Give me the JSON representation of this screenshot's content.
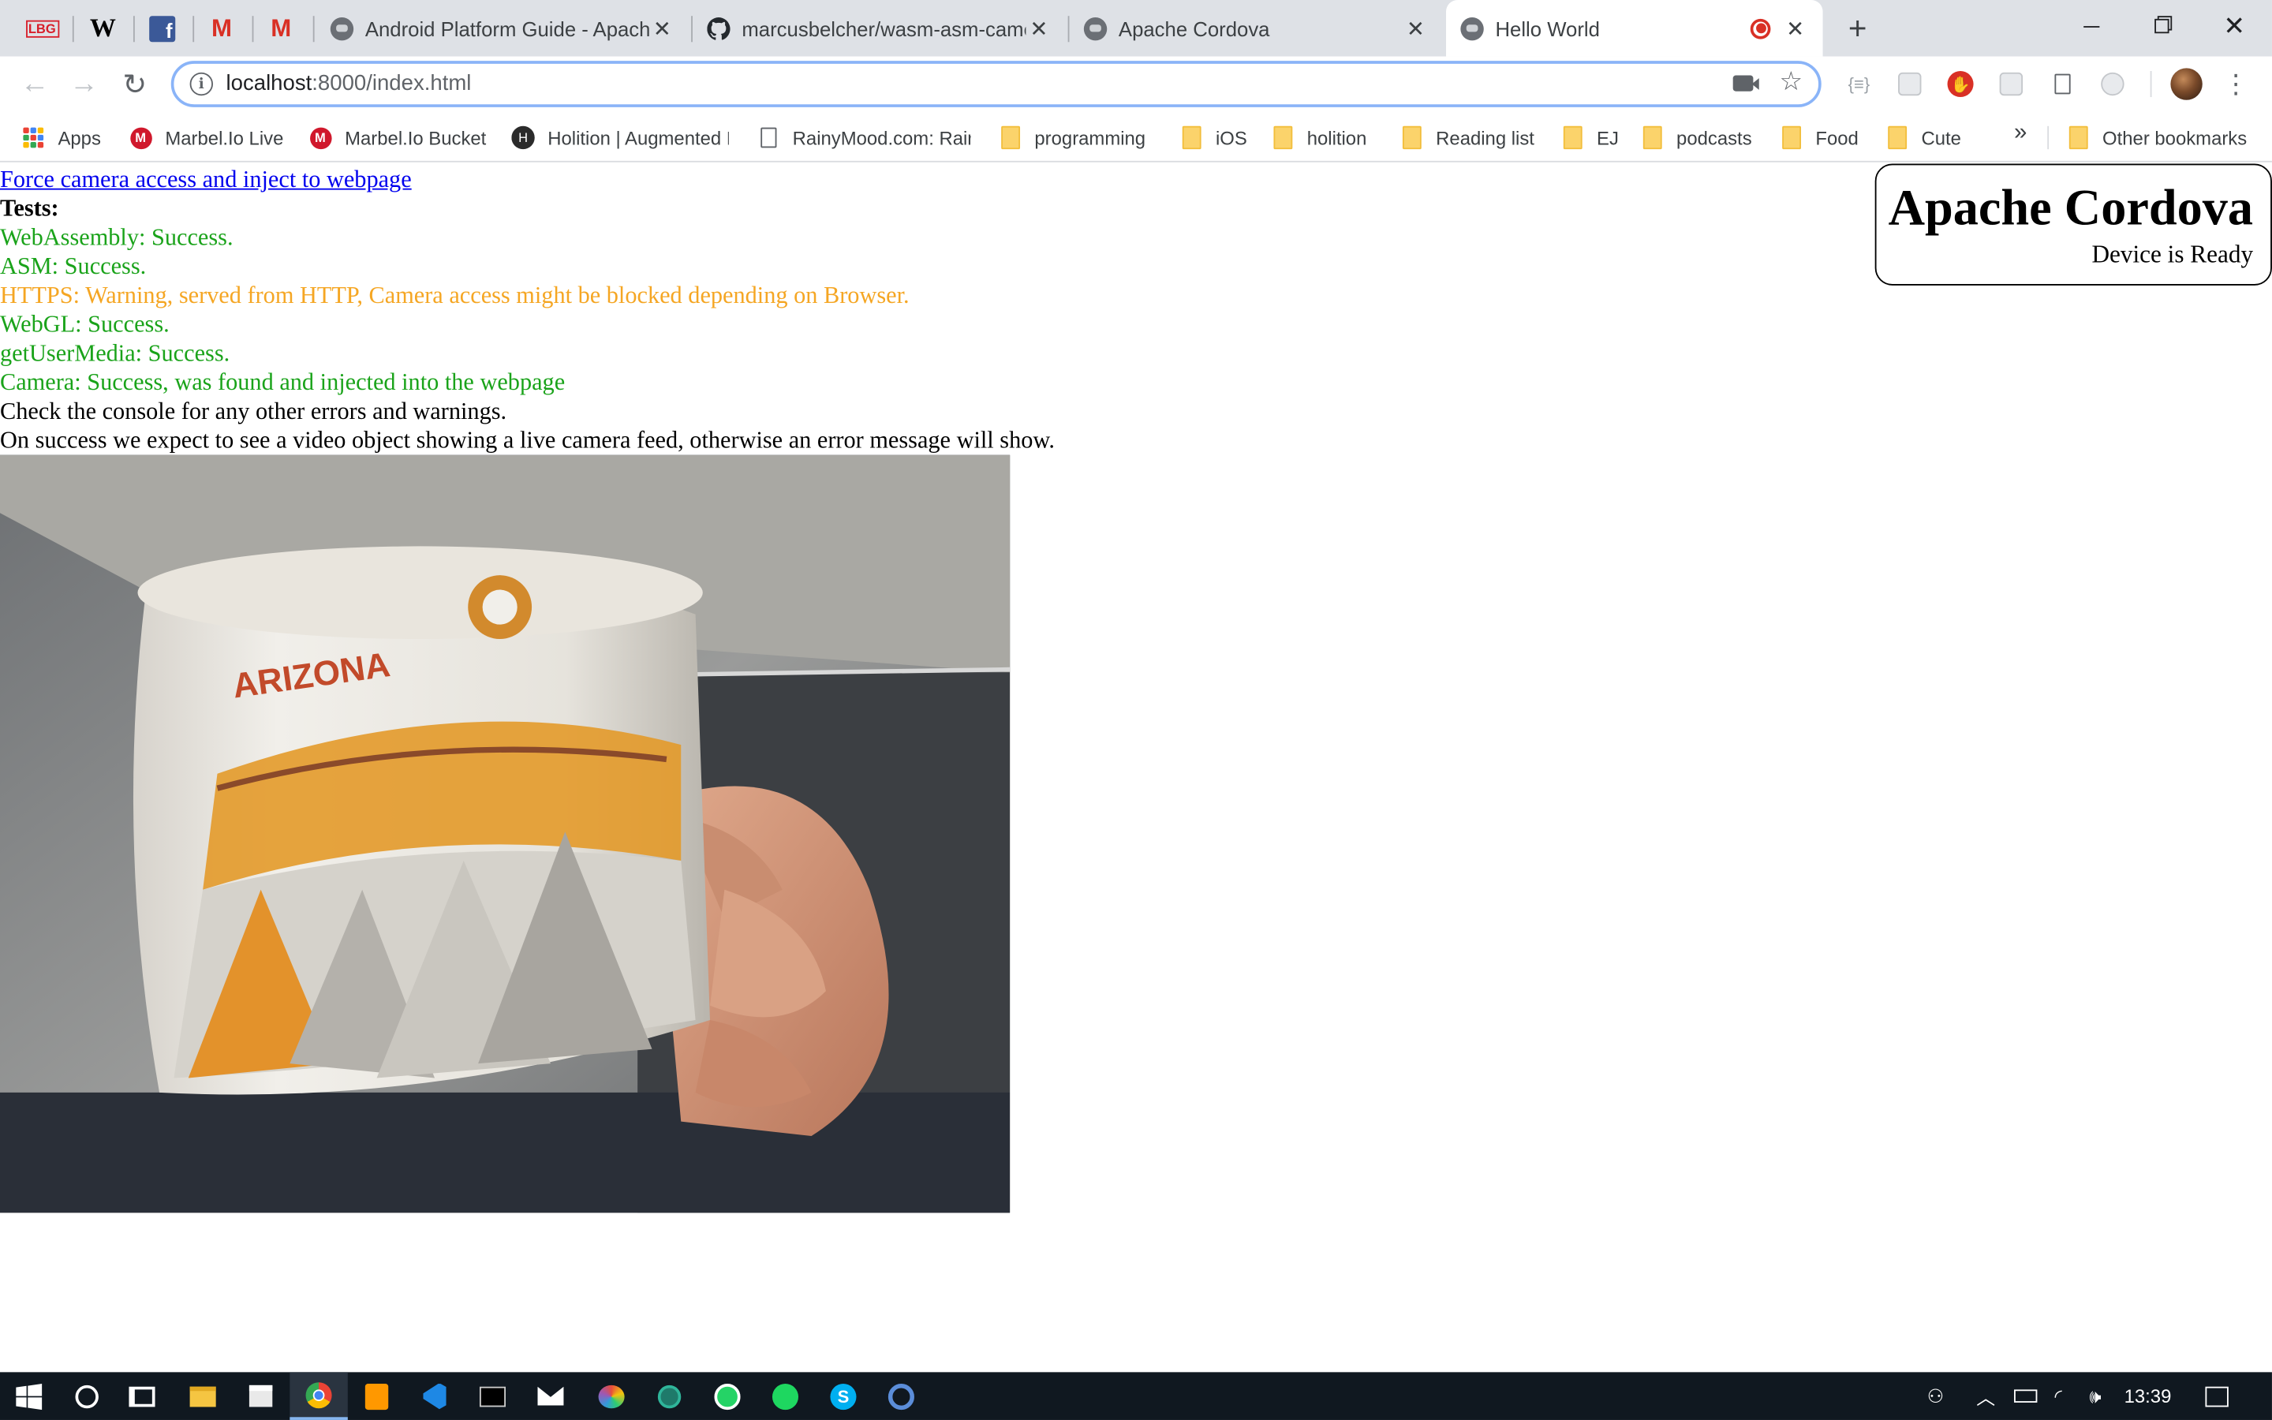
{
  "browser": {
    "pinned_tabs": [
      {
        "name": "pinned-tab-lbg",
        "text": "LBG"
      },
      {
        "name": "pinned-tab-wikipedia",
        "text": "W"
      },
      {
        "name": "pinned-tab-facebook",
        "text": "f"
      },
      {
        "name": "pinned-tab-gmail-1",
        "text": "M"
      },
      {
        "name": "pinned-tab-gmail-2",
        "text": "M"
      }
    ],
    "tabs": [
      {
        "title": "Android Platform Guide - Apache Cordova"
      },
      {
        "title": "marcusbelcher/wasm-asm-camera-webgl-test"
      },
      {
        "title": "Apache Cordova"
      },
      {
        "title": "Hello World",
        "active": true,
        "recording": true
      }
    ],
    "close_glyph": "✕",
    "new_tab_glyph": "+",
    "url_host": "localhost",
    "url_path": ":8000/index.html",
    "info_glyph": "i",
    "star_glyph": "☆",
    "json_ext_glyph": "{≡}",
    "stop_ext_glyph": "✋",
    "kebab_glyph": "⋮"
  },
  "bookmarks": [
    {
      "label": "Apps",
      "icon": "apps-grid-icon"
    },
    {
      "label": "Marbel.Io Live",
      "icon": "marbel-logo-icon"
    },
    {
      "label": "Marbel.Io Bucket",
      "icon": "marbel-logo-icon"
    },
    {
      "label": "Holition | Augmented Reality",
      "icon": "holition-logo-icon"
    },
    {
      "label": "RainyMood.com: Rain is",
      "icon": "document-icon"
    },
    {
      "label": "programming",
      "icon": "folder-icon"
    },
    {
      "label": "iOS",
      "icon": "folder-icon"
    },
    {
      "label": "holition",
      "icon": "folder-icon"
    },
    {
      "label": "Reading list",
      "icon": "folder-icon"
    },
    {
      "label": "EJ",
      "icon": "folder-icon"
    },
    {
      "label": "podcasts",
      "icon": "folder-icon"
    },
    {
      "label": "Food",
      "icon": "folder-icon"
    },
    {
      "label": "Cute",
      "icon": "folder-icon"
    }
  ],
  "bookmarks_overflow": "»",
  "other_bookmarks": "Other bookmarks",
  "page": {
    "force_link": "Force camera access and inject to webpage",
    "tests_heading": "Tests:",
    "results": [
      {
        "text": "WebAssembly: Success.",
        "status": "success"
      },
      {
        "text": "ASM: Success.",
        "status": "success"
      },
      {
        "text": "HTTPS: Warning, served from HTTP, Camera access might be blocked depending on Browser.",
        "status": "warning"
      },
      {
        "text": "WebGL: Success.",
        "status": "success"
      },
      {
        "text": "getUserMedia: Success.",
        "status": "success"
      },
      {
        "text": "Camera: Success, was found and injected into the webpage",
        "status": "success"
      }
    ],
    "console_note": "Check the console for any other errors and warnings.",
    "expectation_note": "On success we expect to see a video object showing a live camera feed, otherwise an error message will show.",
    "mug_text": "ARIZONA",
    "cordova_title": "Apache Cordova",
    "cordova_status": "Device is Ready"
  },
  "colors": {
    "success": "#1aa31a",
    "warning": "#f5a623",
    "link": "#0000ee"
  },
  "taskbar": {
    "clock": "13:39"
  }
}
